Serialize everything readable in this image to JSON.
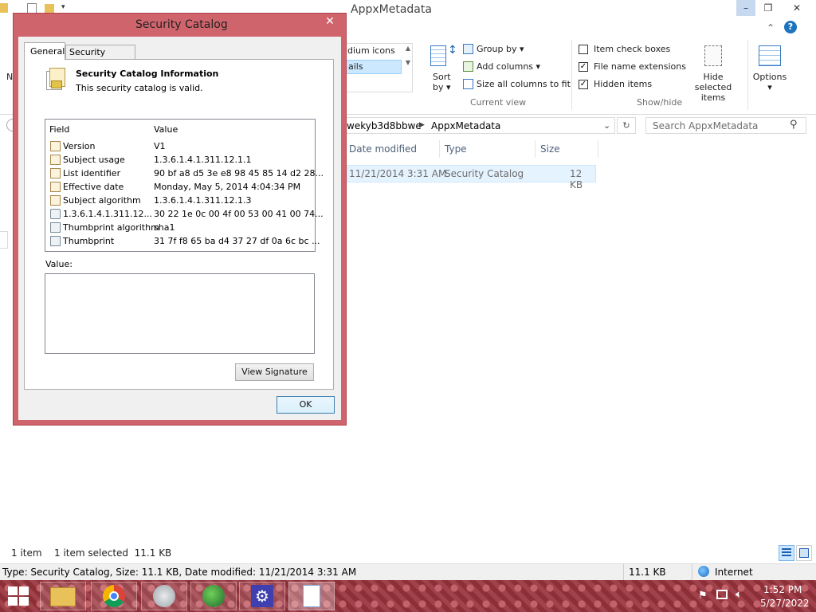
{
  "explorer": {
    "title": "AppxMetadata",
    "caption": {
      "minimize": "–",
      "maximize": "❐",
      "close": "✕"
    },
    "help_glyph": "?",
    "layout": {
      "medium": "dium icons",
      "details": "ails"
    },
    "current_view": {
      "sort_by": "Sort\nby",
      "sort_label": "Sort",
      "sort_by_word": "by",
      "group_by": "Group by",
      "add_columns": "Add columns",
      "size_all_columns": "Size all columns to fit",
      "group_label": "Current view"
    },
    "show_hide": {
      "item_check_boxes": "Item check boxes",
      "file_name_extensions": "File name extensions",
      "hidden_items": "Hidden items",
      "hide_selected_items_1": "Hide selected",
      "hide_selected_items_2": "items",
      "group_label": "Show/hide",
      "check_states": {
        "item_check_boxes": false,
        "file_name_extensions": true,
        "hidden_items": true
      }
    },
    "options_label": "Options",
    "left_label": "N",
    "address": {
      "segment1": "wekyb3d8bbwe",
      "segment2": "AppxMetadata"
    },
    "search_placeholder": "Search AppxMetadata",
    "columns": {
      "date": "Date modified",
      "type": "Type",
      "size": "Size"
    },
    "file": {
      "date": "11/21/2014 3:31 AM",
      "type": "Security Catalog",
      "size": "12 KB"
    },
    "status": {
      "items": "1 item",
      "selected": "1 item selected  11.1 KB"
    },
    "details_bar": {
      "info": "Type: Security Catalog, Size: 11.1 KB, Date modified: 11/21/2014 3:31 AM",
      "size": "11.1 KB",
      "zone": "Internet"
    }
  },
  "dialog": {
    "title": "Security Catalog",
    "close": "✕",
    "tabs": [
      "General",
      "Security Catalog"
    ],
    "heading": "Security Catalog Information",
    "status": "This security catalog is valid.",
    "list_headers": {
      "field": "Field",
      "value": "Value"
    },
    "rows": [
      {
        "field": "Version",
        "value": "V1"
      },
      {
        "field": "Subject usage",
        "value": "1.3.6.1.4.1.311.12.1.1"
      },
      {
        "field": "List identifier",
        "value": "90 bf a8 d5 3e e8 98 45 85 14 d2 28..."
      },
      {
        "field": "Effective date",
        "value": "Monday, May 5, 2014 4:04:34 PM"
      },
      {
        "field": "Subject algorithm",
        "value": "1.3.6.1.4.1.311.12.1.3"
      },
      {
        "field": "1.3.6.1.4.1.311.12...",
        "value": "30 22 1e 0c 00 4f 00 53 00 41 00 74..."
      },
      {
        "field": "Thumbprint algorithm",
        "value": "sha1"
      },
      {
        "field": "Thumbprint",
        "value": "31 7f f8 65 ba d4 37 27 df 0a 6c bc ..."
      }
    ],
    "value_label": "Value:",
    "view_signature": "View Signature",
    "ok": "OK"
  },
  "taskbar": {
    "time": "1:52 PM",
    "date": "5/27/2022"
  }
}
